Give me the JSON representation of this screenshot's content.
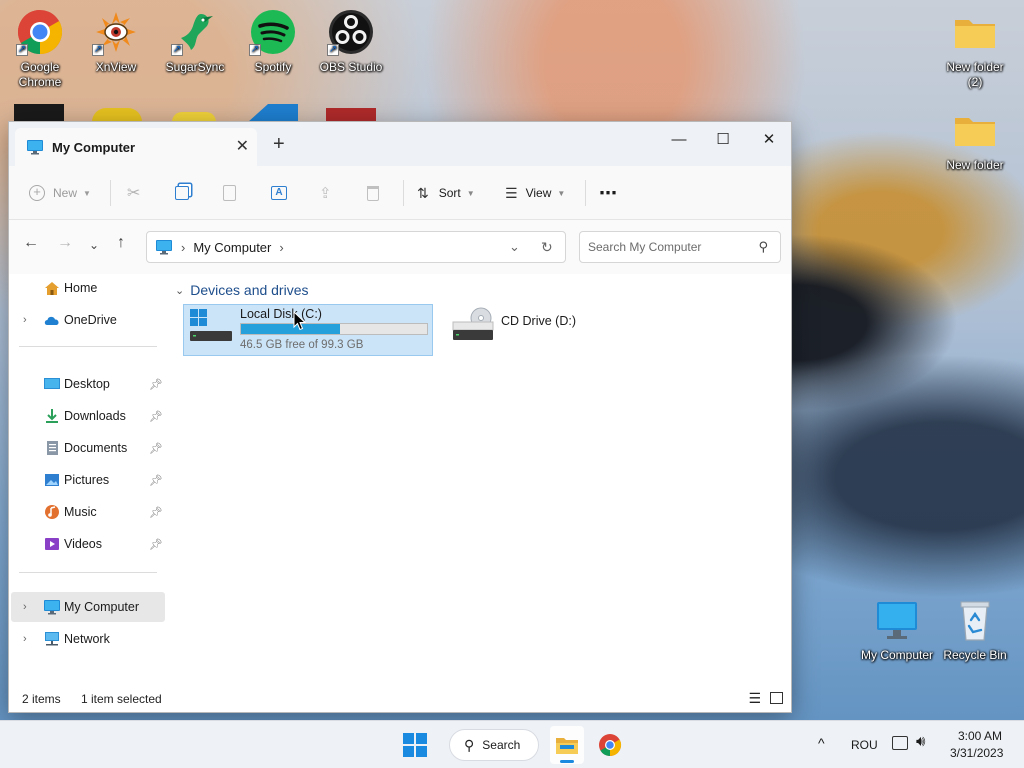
{
  "desktop": {
    "icons_left": [
      {
        "label": "Google Chrome",
        "line1": "Google",
        "line2": "Chrome",
        "icon": "chrome-icon"
      },
      {
        "label": "XnView",
        "icon": "xnview-icon"
      },
      {
        "label": "SugarSync",
        "icon": "sugarsync-icon"
      },
      {
        "label": "Spotify",
        "icon": "spotify-icon"
      },
      {
        "label": "OBS Studio",
        "icon": "obs-icon"
      }
    ],
    "icons_right": [
      {
        "line1": "New folder",
        "line2": "(2)",
        "icon": "folder-icon"
      },
      {
        "line1": "New folder",
        "icon": "folder-icon"
      },
      {
        "line1": "My Computer",
        "icon": "monitor-icon"
      },
      {
        "line1": "Recycle Bin",
        "icon": "recycle-bin-icon"
      }
    ]
  },
  "window": {
    "tab_title": "My Computer",
    "new_tab": "+",
    "controls": {
      "minimize": "—",
      "maximize": "☐",
      "close": "✕"
    },
    "toolbar": {
      "new_label": "New",
      "sort_label": "Sort",
      "view_label": "View",
      "more_label": "⋯"
    },
    "address": {
      "crumb": "My Computer",
      "search_placeholder": "Search My Computer"
    },
    "sidebar": {
      "home": "Home",
      "onedrive": "OneDrive",
      "pinned": [
        {
          "label": "Desktop",
          "icon": "desktop-icon",
          "color": "#2a8fd4"
        },
        {
          "label": "Downloads",
          "icon": "download-icon",
          "color": "#2aa05a"
        },
        {
          "label": "Documents",
          "icon": "document-icon",
          "color": "#7a8796"
        },
        {
          "label": "Pictures",
          "icon": "pictures-icon",
          "color": "#2f7fd0"
        },
        {
          "label": "Music",
          "icon": "music-icon",
          "color": "#e2702e"
        },
        {
          "label": "Videos",
          "icon": "videos-icon",
          "color": "#8a3fc7"
        }
      ],
      "my_computer": "My Computer",
      "network": "Network"
    },
    "content": {
      "group_title": "Devices and drives",
      "drives": [
        {
          "name": "Local Disk (C:)",
          "free_text": "46.5 GB free of 99.3 GB",
          "used_fraction": 0.53,
          "selected": true
        },
        {
          "name": "CD Drive (D:)",
          "selected": false
        }
      ]
    },
    "status": {
      "items": "2 items",
      "selected": "1 item selected"
    }
  },
  "taskbar": {
    "search_label": "Search",
    "language": "ROU",
    "time": "3:00 AM",
    "date": "3/31/2023"
  }
}
